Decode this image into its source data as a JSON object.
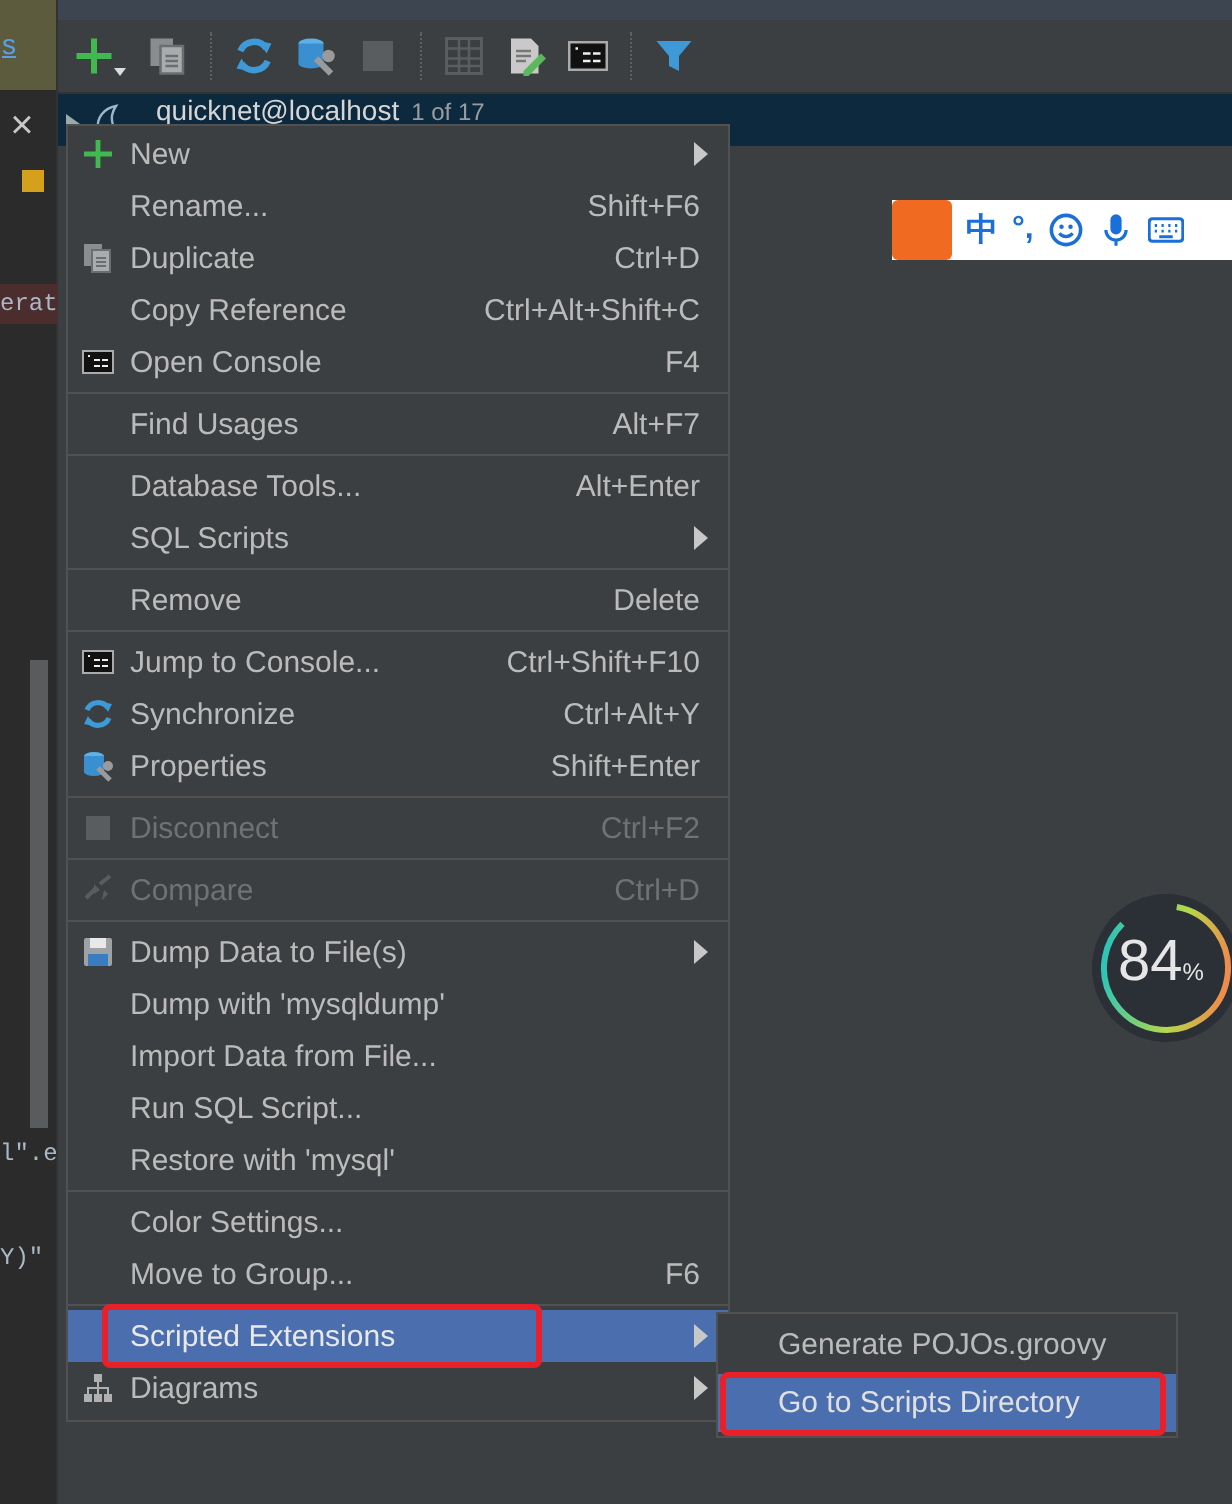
{
  "editor_strip": {
    "tab": "s",
    "close": "×",
    "fragments": [
      {
        "text": "erat",
        "kind": "error"
      },
      {
        "text": "l\".e",
        "kind": "plain"
      },
      {
        "text": "Y)\"",
        "kind": "plain"
      }
    ]
  },
  "toolbar": {
    "items": [
      {
        "kind": "button"
      },
      {
        "kind": "button"
      },
      {
        "kind": "separator"
      },
      {
        "kind": "button"
      },
      {
        "kind": "button"
      },
      {
        "kind": "button"
      },
      {
        "kind": "separator"
      },
      {
        "kind": "button"
      },
      {
        "kind": "button"
      },
      {
        "kind": "button"
      },
      {
        "kind": "separator"
      },
      {
        "kind": "button"
      }
    ]
  },
  "tree": {
    "rows": [
      {
        "name": "quicknet@localhost",
        "detail": "1 of 17",
        "selected": true
      }
    ]
  },
  "context_menu": {
    "items": [
      {
        "kind": "item",
        "label": "New",
        "submenu": true,
        "disabled": false,
        "selected": false
      },
      {
        "kind": "item",
        "label": "Rename...",
        "shortcut": "Shift+F6",
        "submenu": false,
        "disabled": false,
        "selected": false
      },
      {
        "kind": "item",
        "label": "Duplicate",
        "shortcut": "Ctrl+D",
        "submenu": false,
        "disabled": false,
        "selected": false
      },
      {
        "kind": "item",
        "label": "Copy Reference",
        "shortcut": "Ctrl+Alt+Shift+C",
        "submenu": false,
        "disabled": false,
        "selected": false
      },
      {
        "kind": "item",
        "label": "Open Console",
        "shortcut": "F4",
        "submenu": false,
        "disabled": false,
        "selected": false
      },
      {
        "kind": "separator"
      },
      {
        "kind": "item",
        "label": "Find Usages",
        "shortcut": "Alt+F7",
        "submenu": false,
        "disabled": false,
        "selected": false
      },
      {
        "kind": "separator"
      },
      {
        "kind": "item",
        "label": "Database Tools...",
        "shortcut": "Alt+Enter",
        "submenu": false,
        "disabled": false,
        "selected": false
      },
      {
        "kind": "item",
        "label": "SQL Scripts",
        "submenu": true,
        "disabled": false,
        "selected": false
      },
      {
        "kind": "separator"
      },
      {
        "kind": "item",
        "label": "Remove",
        "shortcut": "Delete",
        "submenu": false,
        "disabled": false,
        "selected": false
      },
      {
        "kind": "separator"
      },
      {
        "kind": "item",
        "label": "Jump to Console...",
        "shortcut": "Ctrl+Shift+F10",
        "submenu": false,
        "disabled": false,
        "selected": false
      },
      {
        "kind": "item",
        "label": "Synchronize",
        "shortcut": "Ctrl+Alt+Y",
        "submenu": false,
        "disabled": false,
        "selected": false
      },
      {
        "kind": "item",
        "label": "Properties",
        "shortcut": "Shift+Enter",
        "submenu": false,
        "disabled": false,
        "selected": false
      },
      {
        "kind": "separator"
      },
      {
        "kind": "item",
        "label": "Disconnect",
        "shortcut": "Ctrl+F2",
        "submenu": false,
        "disabled": true,
        "selected": false
      },
      {
        "kind": "separator"
      },
      {
        "kind": "item",
        "label": "Compare",
        "shortcut": "Ctrl+D",
        "submenu": false,
        "disabled": true,
        "selected": false
      },
      {
        "kind": "separator"
      },
      {
        "kind": "item",
        "label": "Dump Data to File(s)",
        "submenu": true,
        "disabled": false,
        "selected": false
      },
      {
        "kind": "item",
        "label": "Dump with 'mysqldump'",
        "submenu": false,
        "disabled": false,
        "selected": false
      },
      {
        "kind": "item",
        "label": "Import Data from File...",
        "submenu": false,
        "disabled": false,
        "selected": false
      },
      {
        "kind": "item",
        "label": "Run SQL Script...",
        "submenu": false,
        "disabled": false,
        "selected": false
      },
      {
        "kind": "item",
        "label": "Restore with 'mysql'",
        "submenu": false,
        "disabled": false,
        "selected": false
      },
      {
        "kind": "separator"
      },
      {
        "kind": "item",
        "label": "Color Settings...",
        "submenu": false,
        "disabled": false,
        "selected": false
      },
      {
        "kind": "item",
        "label": "Move to Group...",
        "shortcut": "F6",
        "submenu": false,
        "disabled": false,
        "selected": false
      },
      {
        "kind": "separator"
      },
      {
        "kind": "item",
        "label": "Scripted Extensions",
        "submenu": true,
        "disabled": false,
        "selected": true,
        "annotated": true
      },
      {
        "kind": "item",
        "label": "Diagrams",
        "submenu": true,
        "disabled": false,
        "selected": false
      }
    ]
  },
  "submenu": {
    "items": [
      {
        "label": "Generate POJOs.groovy",
        "selected": false,
        "annotated": false
      },
      {
        "label": "Go to Scripts Directory",
        "selected": true,
        "annotated": true
      }
    ]
  },
  "ime_bar": {
    "mode": "中",
    "punctuation": "°,"
  },
  "memory_widget": {
    "value": "84",
    "unit": "%"
  }
}
